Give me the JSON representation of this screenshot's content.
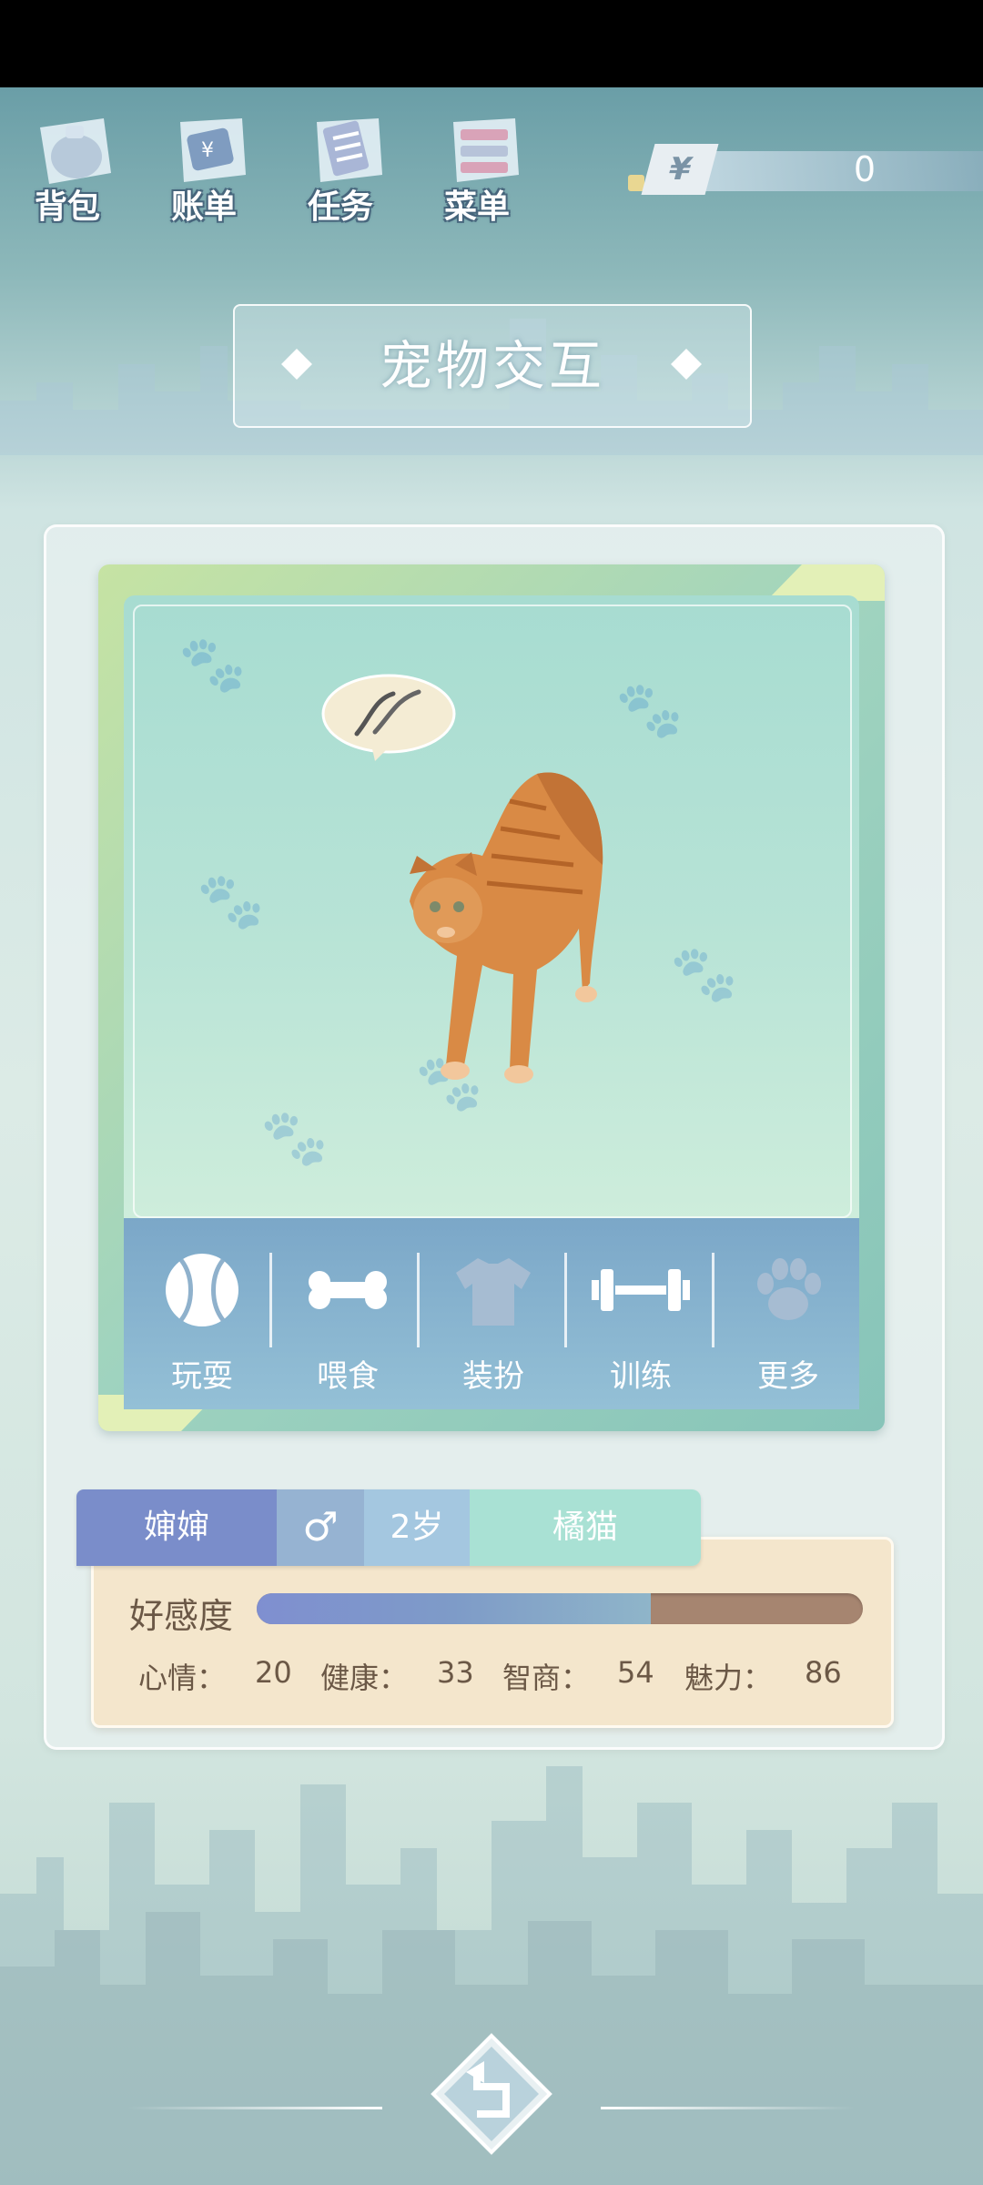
{
  "nav": {
    "items": [
      {
        "label": "背包",
        "icon": "backpack-icon"
      },
      {
        "label": "账单",
        "icon": "bill-icon"
      },
      {
        "label": "任务",
        "icon": "task-icon"
      },
      {
        "label": "菜单",
        "icon": "menu-icon"
      }
    ],
    "currency": {
      "symbol": "¥",
      "value": "0"
    }
  },
  "title": "宠物交互",
  "actions": [
    {
      "label": "玩耍",
      "icon": "ball-icon"
    },
    {
      "label": "喂食",
      "icon": "bone-icon"
    },
    {
      "label": "装扮",
      "icon": "shirt-icon"
    },
    {
      "label": "训练",
      "icon": "dumbbell-icon"
    },
    {
      "label": "更多",
      "icon": "paw-icon"
    }
  ],
  "pet": {
    "name": "婶婶",
    "gender_symbol": "♂",
    "age": "2岁",
    "breed": "橘猫",
    "affinity_label": "好感度",
    "affinity_fraction": 0.65,
    "stats": [
      {
        "label": "心情：",
        "value": "20"
      },
      {
        "label": "健康：",
        "value": "33"
      },
      {
        "label": "智商：",
        "value": "54"
      },
      {
        "label": "魅力：",
        "value": "86"
      }
    ]
  },
  "colors": {
    "accent": "#7a8dca",
    "affinity_track": "#a68570",
    "panel": "#f4e6cc"
  }
}
